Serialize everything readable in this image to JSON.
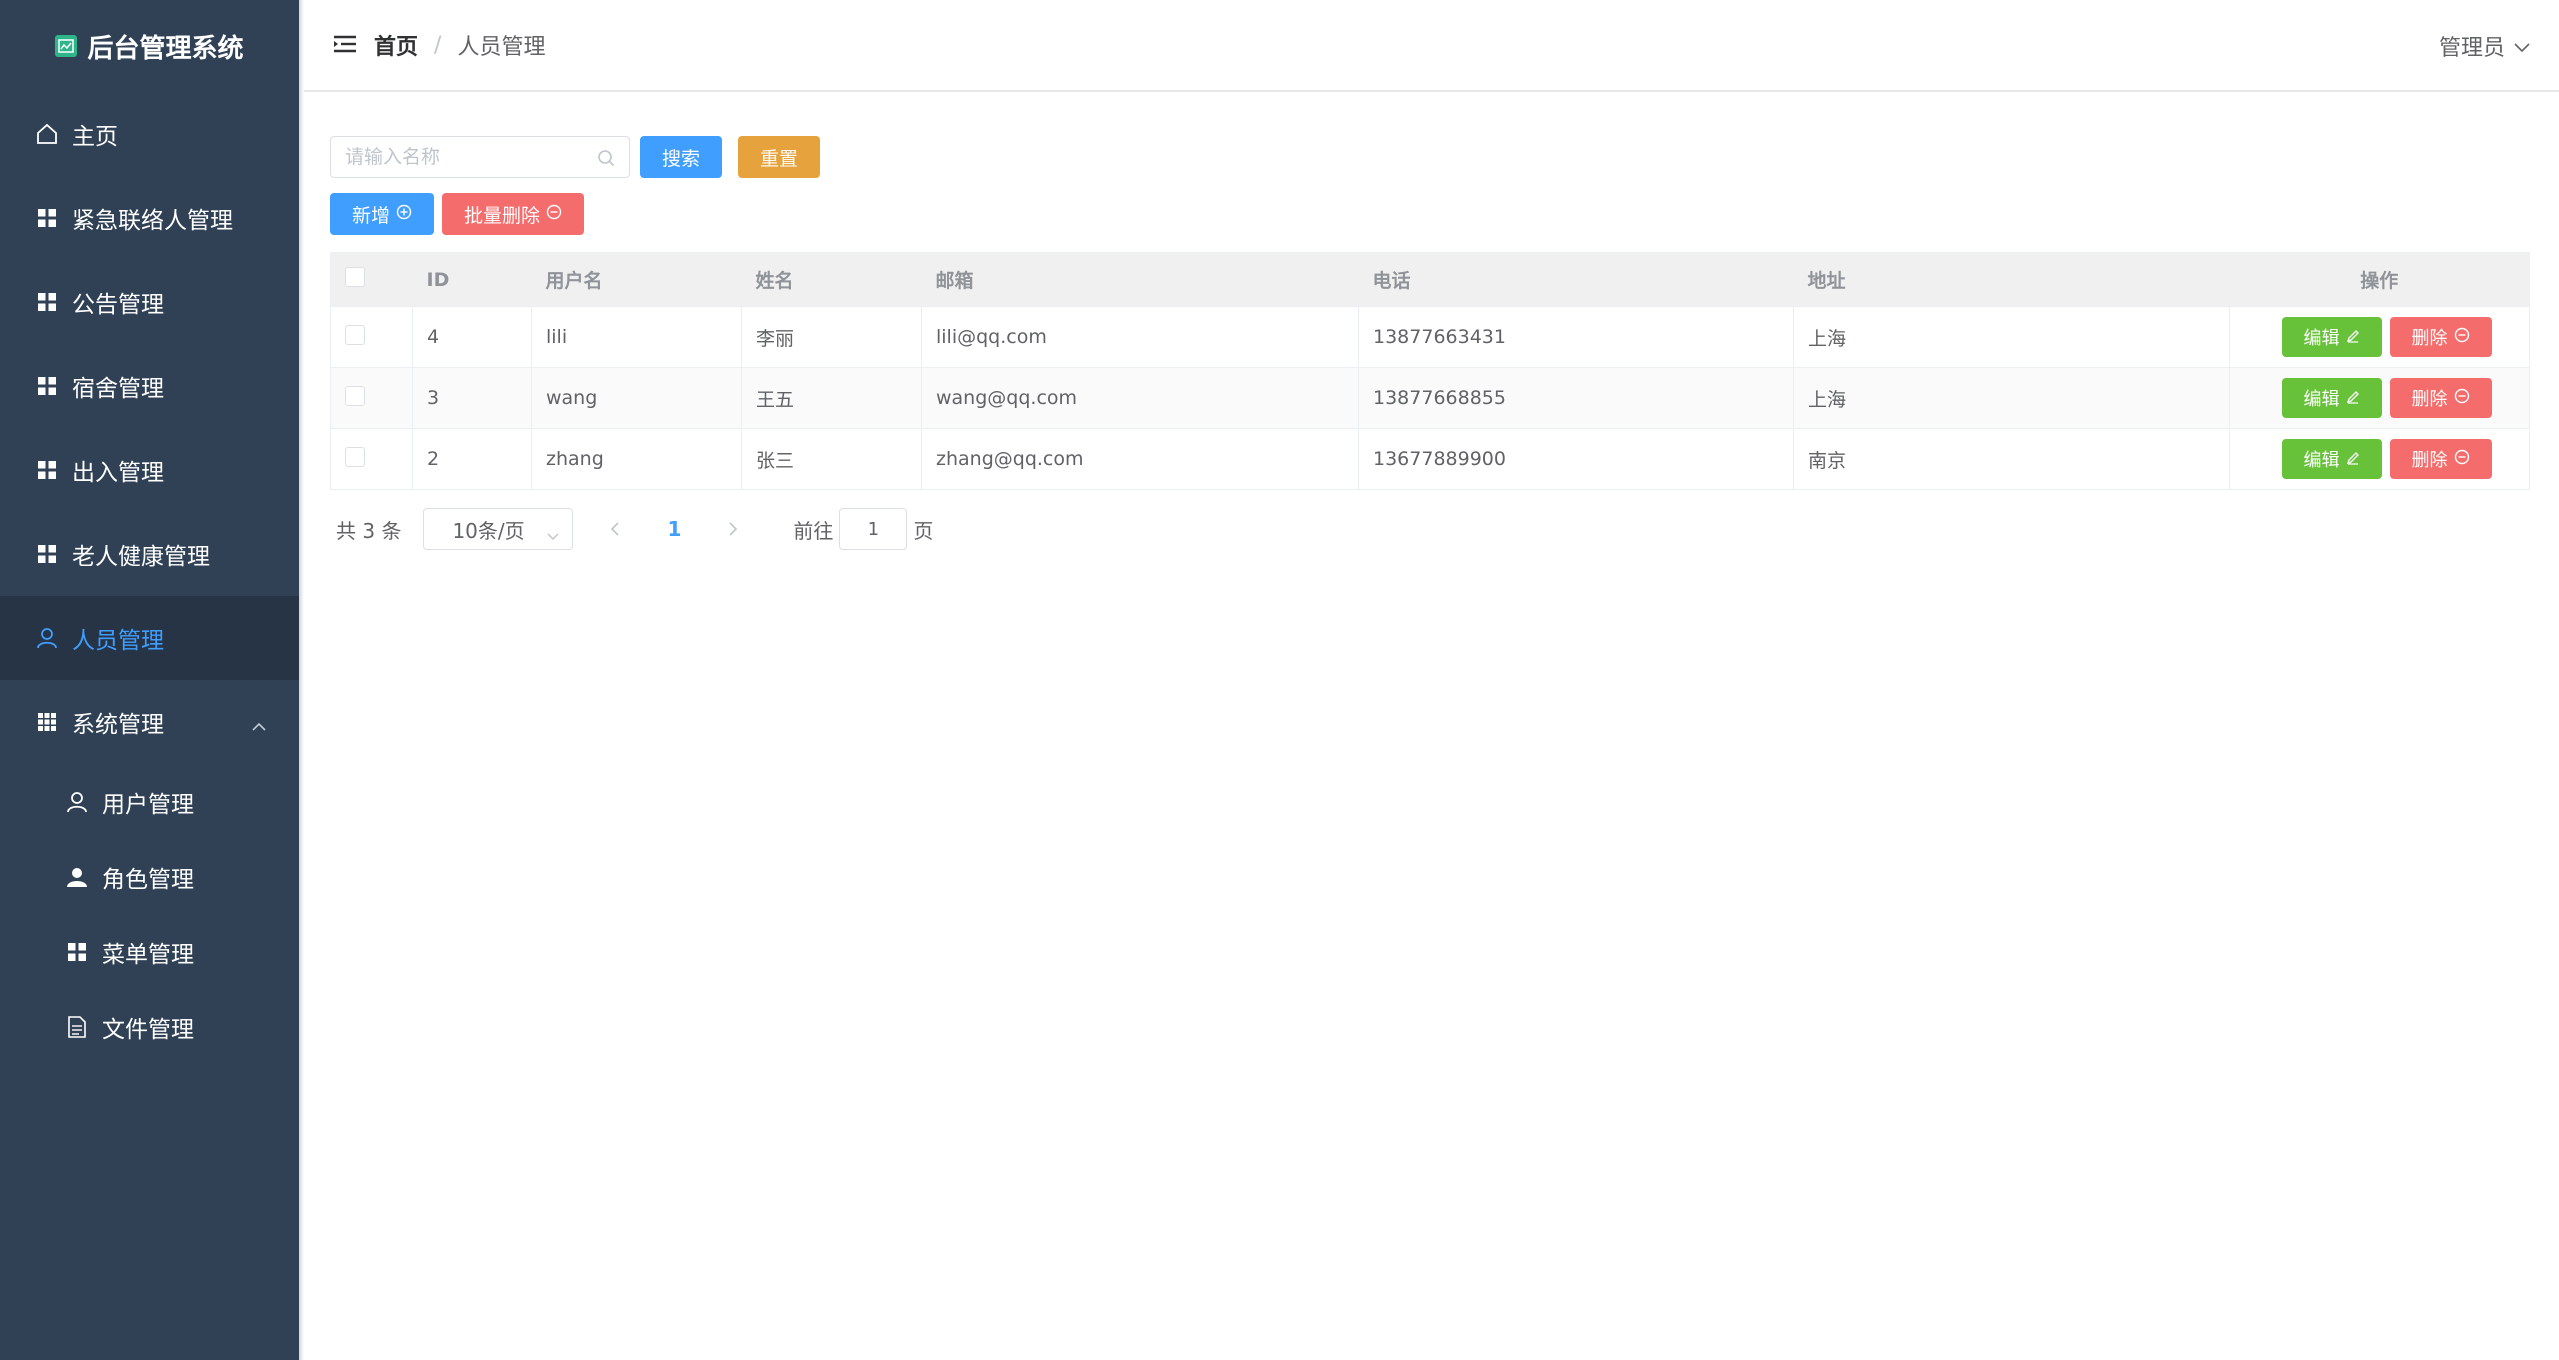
{
  "app": {
    "title": "后台管理系统"
  },
  "sidebar": {
    "items": [
      {
        "label": "主页",
        "icon": "home-icon"
      },
      {
        "label": "紧急联络人管理",
        "icon": "grid-icon"
      },
      {
        "label": "公告管理",
        "icon": "grid-icon"
      },
      {
        "label": "宿舍管理",
        "icon": "grid-icon"
      },
      {
        "label": "出入管理",
        "icon": "grid-icon"
      },
      {
        "label": "老人健康管理",
        "icon": "grid-icon"
      },
      {
        "label": "人员管理",
        "icon": "user-icon",
        "active": true
      }
    ],
    "system": {
      "label": "系统管理",
      "icon": "menu-grid-icon",
      "children": [
        {
          "label": "用户管理",
          "icon": "user-icon"
        },
        {
          "label": "角色管理",
          "icon": "person-solid-icon"
        },
        {
          "label": "菜单管理",
          "icon": "grid-icon"
        },
        {
          "label": "文件管理",
          "icon": "document-icon"
        }
      ]
    }
  },
  "header": {
    "breadcrumb_home": "首页",
    "breadcrumb_sep": "/",
    "breadcrumb_current": "人员管理",
    "user_label": "管理员"
  },
  "toolbar": {
    "search_placeholder": "请输入名称",
    "search_label": "搜索",
    "reset_label": "重置",
    "add_label": "新增",
    "batch_delete_label": "批量删除"
  },
  "table": {
    "columns": [
      "ID",
      "用户名",
      "姓名",
      "邮箱",
      "电话",
      "地址",
      "操作"
    ],
    "rows": [
      {
        "id": "4",
        "username": "lili",
        "name": "李丽",
        "email": "lili@qq.com",
        "phone": "13877663431",
        "address": "上海"
      },
      {
        "id": "3",
        "username": "wang",
        "name": "王五",
        "email": "wang@qq.com",
        "phone": "13877668855",
        "address": "上海"
      },
      {
        "id": "2",
        "username": "zhang",
        "name": "张三",
        "email": "zhang@qq.com",
        "phone": "13677889900",
        "address": "南京"
      }
    ],
    "edit_label": "编辑",
    "delete_label": "删除"
  },
  "pagination": {
    "total_text": "共 3 条",
    "page_size": "10条/页",
    "current_page": "1",
    "goto_label": "前往",
    "goto_value": "1",
    "goto_suffix": "页"
  },
  "colors": {
    "sidebar_bg": "#304156",
    "sidebar_active_bg": "#263445",
    "accent": "#409eff",
    "warning": "#e6a23c",
    "danger": "#f56c6c",
    "success": "#67c23a"
  }
}
